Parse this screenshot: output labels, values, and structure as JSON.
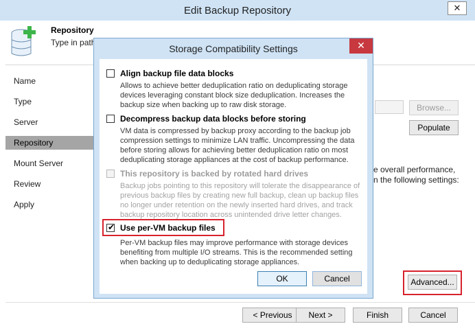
{
  "window": {
    "title": "Edit Backup Repository",
    "close_glyph": "✕"
  },
  "header": {
    "title": "Repository",
    "subtitle": "Type in path t",
    "icon": "database-add-icon"
  },
  "nav": {
    "items": [
      {
        "label": "Name"
      },
      {
        "label": "Type"
      },
      {
        "label": "Server"
      },
      {
        "label": "Repository",
        "selected": true
      },
      {
        "label": "Mount Server"
      },
      {
        "label": "Review"
      },
      {
        "label": "Apply"
      }
    ]
  },
  "main": {
    "browse_label": "Browse...",
    "populate_label": "Populate",
    "perf_line1": "e overall performance,",
    "perf_line2": "n the following settings:",
    "advanced_label": "Advanced..."
  },
  "footer": {
    "previous_label": "< Previous",
    "next_label": "Next >",
    "finish_label": "Finish",
    "cancel_label": "Cancel"
  },
  "dialog": {
    "title": "Storage Compatibility Settings",
    "close_glyph": "✕",
    "options": [
      {
        "label": "Align backup file data blocks",
        "checked": false,
        "enabled": true,
        "desc": [
          "Allows to achieve better deduplication ratio on deduplicating storage",
          "devices leveraging constant block size deduplication. Increases the",
          "backup size when backing up to raw disk storage."
        ]
      },
      {
        "label": "Decompress backup data blocks before storing",
        "checked": false,
        "enabled": true,
        "desc": [
          "VM data is compressed by backup proxy according to the backup job",
          "compression settings to minimize LAN traffic. Uncompressing the data",
          "before storing allows for achieving better deduplication ratio on most",
          "deduplicating storage appliances at the cost of backup performance."
        ]
      },
      {
        "label": "This repository is backed by rotated hard drives",
        "checked": false,
        "enabled": false,
        "desc": [
          "Backup jobs pointing to this repository will tolerate the disappearance of",
          "previous backup files by creating new full backup, clean up backup files",
          "no longer under retention on the newly inserted hard drives, and track",
          "backup repository location across unintended drive letter changes."
        ]
      },
      {
        "label": "Use per-VM backup files",
        "checked": true,
        "enabled": true,
        "desc": [
          "Per-VM backup files may improve performance with storage devices",
          "benefiting from multiple I/O streams. This is the recommended setting",
          "when backing up to deduplicating storage appliances."
        ]
      }
    ],
    "ok_label": "OK",
    "cancel_label": "Cancel"
  },
  "colors": {
    "highlight_red": "#d7222c",
    "titlebar": "#cfe3f5",
    "nav_selected": "#a5a5a5"
  }
}
